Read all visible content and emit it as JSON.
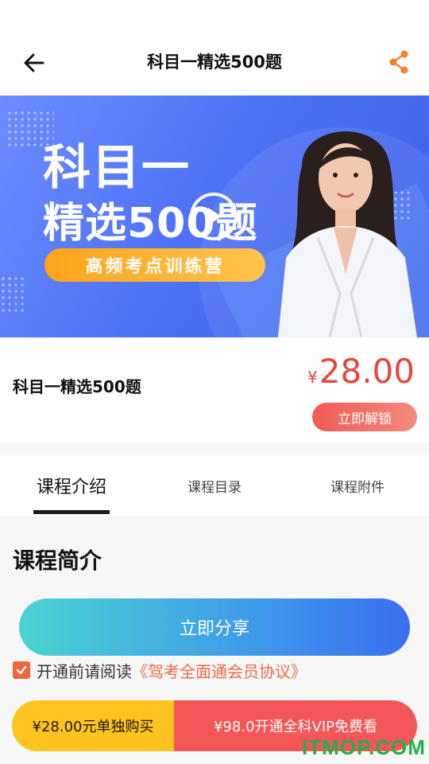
{
  "header": {
    "title": "科目一精选500题",
    "back_icon": "arrow-left-icon",
    "share_icon": "share-icon"
  },
  "banner": {
    "line1": "科目一",
    "line2": "精选500题",
    "pill": "高频考点训练营",
    "play_icon": "play-icon"
  },
  "course": {
    "name": "科目一精选500题",
    "currency": "¥",
    "price": "28.00",
    "unlock_label": "立即解锁"
  },
  "tabs": [
    {
      "label": "课程介绍",
      "active": true
    },
    {
      "label": "课程目录",
      "active": false
    },
    {
      "label": "课程附件",
      "active": false
    }
  ],
  "content": {
    "section_title": "课程简介",
    "share_button": "立即分享"
  },
  "agreement": {
    "checked": true,
    "prefix": "开通前请阅读",
    "link": "《驾考全面通会员协议》"
  },
  "purchase": {
    "single": "¥28.00元单独购买",
    "vip": "¥98.0开通全科VIP免费看"
  },
  "watermark": "ITMOP.COM",
  "colors": {
    "accent_red": "#e8463c",
    "banner_blue": "#4f73f6",
    "buy_yellow": "#ffc31f",
    "buy_red": "#f35656",
    "share_orange": "#f5822a"
  }
}
